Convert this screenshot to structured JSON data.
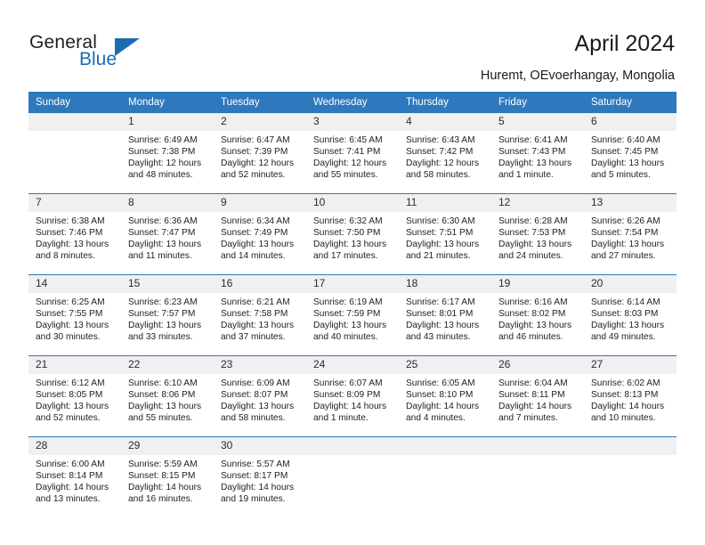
{
  "brand": {
    "name_part1": "General",
    "name_part2": "Blue"
  },
  "header": {
    "title": "April 2024",
    "subtitle": "Huremt, OEvoerhangay, Mongolia"
  },
  "colors": {
    "header_blue": "#2e78bd",
    "brand_blue": "#1b6cb3",
    "daynum_band": "#f0f0f0"
  },
  "weekdays": [
    "Sunday",
    "Monday",
    "Tuesday",
    "Wednesday",
    "Thursday",
    "Friday",
    "Saturday"
  ],
  "labels": {
    "sunrise_prefix": "Sunrise:",
    "sunset_prefix": "Sunset:",
    "daylight_prefix": "Daylight:"
  },
  "weeks": [
    [
      {
        "day": "",
        "lines": []
      },
      {
        "day": "1",
        "lines": [
          "Sunrise: 6:49 AM",
          "Sunset: 7:38 PM",
          "Daylight: 12 hours",
          "and 48 minutes."
        ]
      },
      {
        "day": "2",
        "lines": [
          "Sunrise: 6:47 AM",
          "Sunset: 7:39 PM",
          "Daylight: 12 hours",
          "and 52 minutes."
        ]
      },
      {
        "day": "3",
        "lines": [
          "Sunrise: 6:45 AM",
          "Sunset: 7:41 PM",
          "Daylight: 12 hours",
          "and 55 minutes."
        ]
      },
      {
        "day": "4",
        "lines": [
          "Sunrise: 6:43 AM",
          "Sunset: 7:42 PM",
          "Daylight: 12 hours",
          "and 58 minutes."
        ]
      },
      {
        "day": "5",
        "lines": [
          "Sunrise: 6:41 AM",
          "Sunset: 7:43 PM",
          "Daylight: 13 hours",
          "and 1 minute."
        ]
      },
      {
        "day": "6",
        "lines": [
          "Sunrise: 6:40 AM",
          "Sunset: 7:45 PM",
          "Daylight: 13 hours",
          "and 5 minutes."
        ]
      }
    ],
    [
      {
        "day": "7",
        "lines": [
          "Sunrise: 6:38 AM",
          "Sunset: 7:46 PM",
          "Daylight: 13 hours",
          "and 8 minutes."
        ]
      },
      {
        "day": "8",
        "lines": [
          "Sunrise: 6:36 AM",
          "Sunset: 7:47 PM",
          "Daylight: 13 hours",
          "and 11 minutes."
        ]
      },
      {
        "day": "9",
        "lines": [
          "Sunrise: 6:34 AM",
          "Sunset: 7:49 PM",
          "Daylight: 13 hours",
          "and 14 minutes."
        ]
      },
      {
        "day": "10",
        "lines": [
          "Sunrise: 6:32 AM",
          "Sunset: 7:50 PM",
          "Daylight: 13 hours",
          "and 17 minutes."
        ]
      },
      {
        "day": "11",
        "lines": [
          "Sunrise: 6:30 AM",
          "Sunset: 7:51 PM",
          "Daylight: 13 hours",
          "and 21 minutes."
        ]
      },
      {
        "day": "12",
        "lines": [
          "Sunrise: 6:28 AM",
          "Sunset: 7:53 PM",
          "Daylight: 13 hours",
          "and 24 minutes."
        ]
      },
      {
        "day": "13",
        "lines": [
          "Sunrise: 6:26 AM",
          "Sunset: 7:54 PM",
          "Daylight: 13 hours",
          "and 27 minutes."
        ]
      }
    ],
    [
      {
        "day": "14",
        "lines": [
          "Sunrise: 6:25 AM",
          "Sunset: 7:55 PM",
          "Daylight: 13 hours",
          "and 30 minutes."
        ]
      },
      {
        "day": "15",
        "lines": [
          "Sunrise: 6:23 AM",
          "Sunset: 7:57 PM",
          "Daylight: 13 hours",
          "and 33 minutes."
        ]
      },
      {
        "day": "16",
        "lines": [
          "Sunrise: 6:21 AM",
          "Sunset: 7:58 PM",
          "Daylight: 13 hours",
          "and 37 minutes."
        ]
      },
      {
        "day": "17",
        "lines": [
          "Sunrise: 6:19 AM",
          "Sunset: 7:59 PM",
          "Daylight: 13 hours",
          "and 40 minutes."
        ]
      },
      {
        "day": "18",
        "lines": [
          "Sunrise: 6:17 AM",
          "Sunset: 8:01 PM",
          "Daylight: 13 hours",
          "and 43 minutes."
        ]
      },
      {
        "day": "19",
        "lines": [
          "Sunrise: 6:16 AM",
          "Sunset: 8:02 PM",
          "Daylight: 13 hours",
          "and 46 minutes."
        ]
      },
      {
        "day": "20",
        "lines": [
          "Sunrise: 6:14 AM",
          "Sunset: 8:03 PM",
          "Daylight: 13 hours",
          "and 49 minutes."
        ]
      }
    ],
    [
      {
        "day": "21",
        "lines": [
          "Sunrise: 6:12 AM",
          "Sunset: 8:05 PM",
          "Daylight: 13 hours",
          "and 52 minutes."
        ]
      },
      {
        "day": "22",
        "lines": [
          "Sunrise: 6:10 AM",
          "Sunset: 8:06 PM",
          "Daylight: 13 hours",
          "and 55 minutes."
        ]
      },
      {
        "day": "23",
        "lines": [
          "Sunrise: 6:09 AM",
          "Sunset: 8:07 PM",
          "Daylight: 13 hours",
          "and 58 minutes."
        ]
      },
      {
        "day": "24",
        "lines": [
          "Sunrise: 6:07 AM",
          "Sunset: 8:09 PM",
          "Daylight: 14 hours",
          "and 1 minute."
        ]
      },
      {
        "day": "25",
        "lines": [
          "Sunrise: 6:05 AM",
          "Sunset: 8:10 PM",
          "Daylight: 14 hours",
          "and 4 minutes."
        ]
      },
      {
        "day": "26",
        "lines": [
          "Sunrise: 6:04 AM",
          "Sunset: 8:11 PM",
          "Daylight: 14 hours",
          "and 7 minutes."
        ]
      },
      {
        "day": "27",
        "lines": [
          "Sunrise: 6:02 AM",
          "Sunset: 8:13 PM",
          "Daylight: 14 hours",
          "and 10 minutes."
        ]
      }
    ],
    [
      {
        "day": "28",
        "lines": [
          "Sunrise: 6:00 AM",
          "Sunset: 8:14 PM",
          "Daylight: 14 hours",
          "and 13 minutes."
        ]
      },
      {
        "day": "29",
        "lines": [
          "Sunrise: 5:59 AM",
          "Sunset: 8:15 PM",
          "Daylight: 14 hours",
          "and 16 minutes."
        ]
      },
      {
        "day": "30",
        "lines": [
          "Sunrise: 5:57 AM",
          "Sunset: 8:17 PM",
          "Daylight: 14 hours",
          "and 19 minutes."
        ]
      },
      {
        "day": "",
        "lines": []
      },
      {
        "day": "",
        "lines": []
      },
      {
        "day": "",
        "lines": []
      },
      {
        "day": "",
        "lines": []
      }
    ]
  ]
}
